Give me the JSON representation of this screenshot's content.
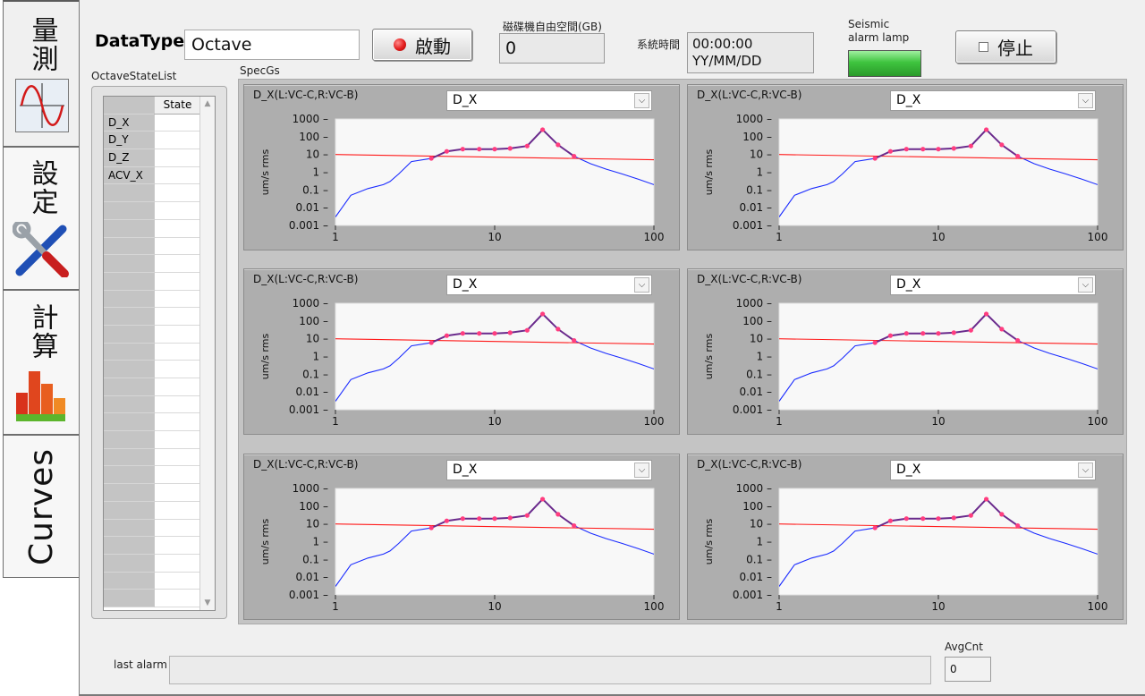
{
  "tabs": [
    {
      "label": "量測",
      "icon": "sine-wave-icon"
    },
    {
      "label": "設定",
      "icon": "tools-icon"
    },
    {
      "label": "計算",
      "icon": "bar-chart-icon"
    },
    {
      "label": "Curves"
    }
  ],
  "header": {
    "datatype_label": "DataType",
    "datatype_value": "Octave",
    "start_button": "啟動",
    "stop_button": "停止",
    "disk_label": "磁碟機自由空間(GB)",
    "disk_value": "0",
    "time_label": "系統時間",
    "time_value": "00:00:00",
    "date_value": "YY/MM/DD",
    "seismic_label_line1": "Seismic",
    "seismic_label_line2": "alarm lamp"
  },
  "colors": {
    "lamp": "#3fc43f",
    "red_led": "#e31b1b",
    "series_blue": "#1a2bff",
    "series_red": "#ff1a1a",
    "series_purple": "#6a2a8c",
    "marker": "#ff3d7f"
  },
  "octave_list": {
    "label": "OctaveStateList",
    "column_header": "State",
    "rows": [
      "D_X",
      "D_Y",
      "D_Z",
      "ACV_X"
    ],
    "total_rows": 28
  },
  "specgs_label": "SpecGs",
  "charts": [
    {
      "title": "D_X(L:VC-C,R:VC-B)",
      "selection": "D_X"
    },
    {
      "title": "D_X(L:VC-C,R:VC-B)",
      "selection": "D_X"
    },
    {
      "title": "D_X(L:VC-C,R:VC-B)",
      "selection": "D_X"
    },
    {
      "title": "D_X(L:VC-C,R:VC-B)",
      "selection": "D_X"
    },
    {
      "title": "D_X(L:VC-C,R:VC-B)",
      "selection": "D_X"
    },
    {
      "title": "D_X(L:VC-C,R:VC-B)",
      "selection": "D_X"
    }
  ],
  "chart_data": {
    "type": "line",
    "ylabel": "um/s rms",
    "x_scale": "log",
    "y_scale": "log",
    "xlim": [
      1,
      100
    ],
    "ylim": [
      0.001,
      1000
    ],
    "x_ticks": [
      "1",
      "10",
      "100"
    ],
    "y_ticks": [
      "1000",
      "100",
      "10",
      "1",
      "0.1",
      "0.01",
      "0.001"
    ],
    "series": [
      {
        "color": "blue",
        "x": [
          1,
          1.25,
          1.6,
          2,
          2.2,
          2.5,
          3,
          4,
          5,
          6.3,
          8,
          10,
          12.5,
          16,
          20,
          25,
          31.5,
          40,
          50,
          63,
          80,
          100
        ],
        "y": [
          0.003,
          0.05,
          0.12,
          0.2,
          0.3,
          0.8,
          4,
          6,
          15,
          20,
          20,
          20,
          22,
          30,
          250,
          35,
          8,
          3,
          1.5,
          0.8,
          0.4,
          0.2
        ]
      },
      {
        "color": "red",
        "x": [
          1,
          100
        ],
        "y": [
          10,
          5
        ]
      },
      {
        "color": "purple",
        "markers": true,
        "x": [
          4,
          5,
          6.3,
          8,
          10,
          12.5,
          16,
          20,
          25,
          31.5
        ],
        "y": [
          6,
          15,
          20,
          20,
          20,
          22,
          30,
          250,
          35,
          8
        ]
      }
    ]
  },
  "footer": {
    "last_alarm_label": "last alarm",
    "last_alarm_value": "",
    "avgcnt_label": "AvgCnt",
    "avgcnt_value": "0"
  }
}
